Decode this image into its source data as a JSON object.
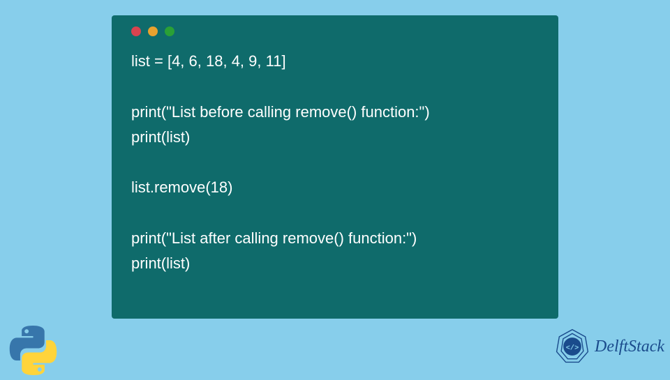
{
  "code": {
    "lines": [
      "list = [4, 6, 18, 4, 9, 11]",
      "",
      "print(\"List before calling remove() function:\")",
      "print(list)",
      "",
      "list.remove(18)",
      "",
      "print(\"List after calling remove() function:\")",
      "print(list)"
    ]
  },
  "brand": {
    "name": "DelftStack"
  },
  "colors": {
    "background": "#87ceeb",
    "codeBg": "#0f6b6b",
    "dotRed": "#d9434f",
    "dotYellow": "#e8a22e",
    "dotGreen": "#2aa036",
    "brandText": "#1a4b8c"
  }
}
